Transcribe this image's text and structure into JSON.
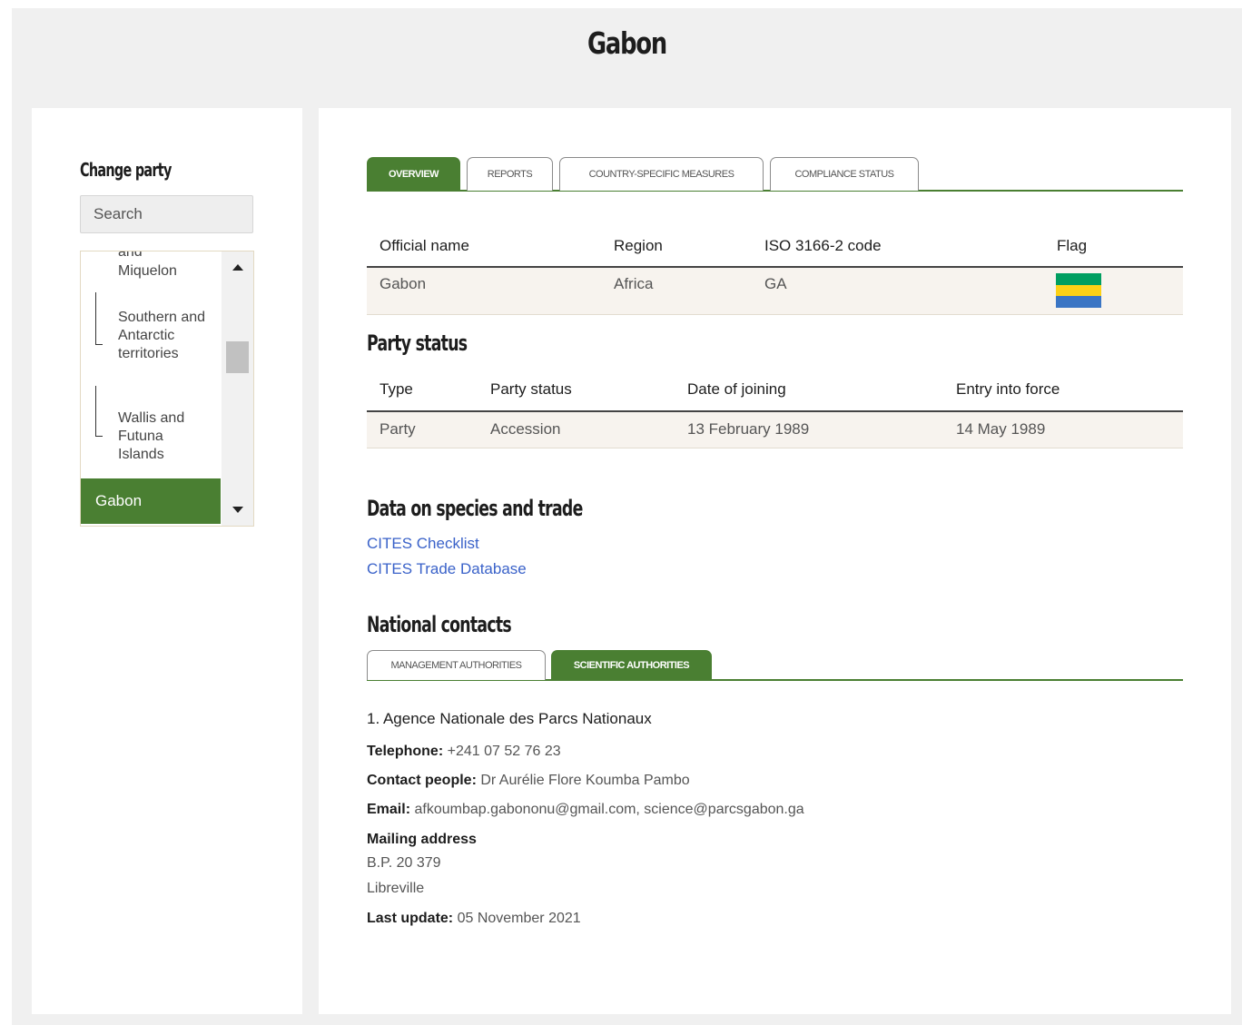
{
  "page": {
    "title": "Gabon"
  },
  "sidebar": {
    "title": "Change party",
    "search_placeholder": "Search",
    "list": {
      "partial_top": "and",
      "items": [
        {
          "label": "Miquelon"
        },
        {
          "label": "Southern and Antarctic territories"
        },
        {
          "label": "Wallis and Futuna Islands"
        }
      ],
      "selected": "Gabon"
    }
  },
  "tabs": [
    {
      "label": "OVERVIEW",
      "active": true
    },
    {
      "label": "REPORTS",
      "active": false
    },
    {
      "label": "COUNTRY-SPECIFIC MEASURES",
      "active": false
    },
    {
      "label": "COMPLIANCE STATUS",
      "active": false
    }
  ],
  "overview": {
    "headers": {
      "official_name": "Official name",
      "region": "Region",
      "iso": "ISO 3166-2 code",
      "flag": "Flag"
    },
    "row": {
      "official_name": "Gabon",
      "region": "Africa",
      "iso": "GA"
    },
    "flag_colors": [
      "#009e60",
      "#fcd116",
      "#3a75c4"
    ]
  },
  "party_status": {
    "heading": "Party status",
    "headers": {
      "type": "Type",
      "status": "Party status",
      "joined": "Date of joining",
      "entry": "Entry into force"
    },
    "row": {
      "type": "Party",
      "status": "Accession",
      "joined": "13 February 1989",
      "entry": "14 May 1989"
    }
  },
  "species_trade": {
    "heading": "Data on species and trade",
    "links": [
      "CITES Checklist",
      "CITES Trade Database"
    ]
  },
  "national_contacts": {
    "heading": "National contacts",
    "tabs": [
      {
        "label": "MANAGEMENT AUTHORITIES",
        "active": false
      },
      {
        "label": "SCIENTIFIC AUTHORITIES",
        "active": true
      }
    ],
    "org": "1. Agence Nationale des Parcs Nationaux",
    "telephone_label": "Telephone:",
    "telephone": "+241 07 52 76 23",
    "contact_label": "Contact people:",
    "contact": "Dr Aurélie Flore Koumba Pambo",
    "email_label": "Email:",
    "email": "afkoumbap.gabononu@gmail.com, science@parcsgabon.ga",
    "mailing_label": "Mailing address",
    "address_line1": "B.P. 20 379",
    "address_line2": "Libreville",
    "update_label": "Last update:",
    "update": "05 November 2021"
  },
  "colors": {
    "accent": "#4a7f32",
    "link": "#3a62c9",
    "background": "#f0f0f0"
  }
}
